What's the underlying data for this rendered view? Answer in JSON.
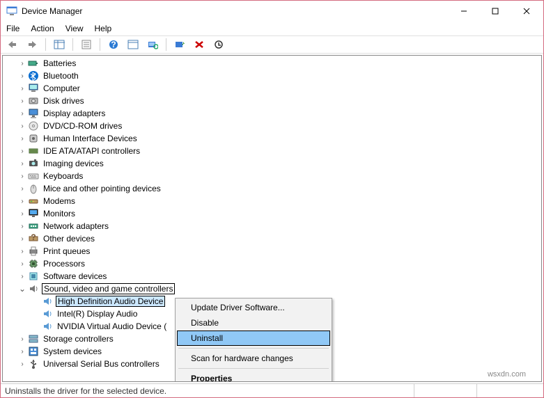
{
  "window": {
    "title": "Device Manager"
  },
  "menu": {
    "file": "File",
    "action": "Action",
    "view": "View",
    "help": "Help"
  },
  "tree": {
    "nodes": [
      {
        "label": "Batteries",
        "expanded": false,
        "icon": "battery"
      },
      {
        "label": "Bluetooth",
        "expanded": false,
        "icon": "bluetooth"
      },
      {
        "label": "Computer",
        "expanded": false,
        "icon": "computer"
      },
      {
        "label": "Disk drives",
        "expanded": false,
        "icon": "disk"
      },
      {
        "label": "Display adapters",
        "expanded": false,
        "icon": "display"
      },
      {
        "label": "DVD/CD-ROM drives",
        "expanded": false,
        "icon": "cd"
      },
      {
        "label": "Human Interface Devices",
        "expanded": false,
        "icon": "hid"
      },
      {
        "label": "IDE ATA/ATAPI controllers",
        "expanded": false,
        "icon": "ide"
      },
      {
        "label": "Imaging devices",
        "expanded": false,
        "icon": "imaging"
      },
      {
        "label": "Keyboards",
        "expanded": false,
        "icon": "keyboard"
      },
      {
        "label": "Mice and other pointing devices",
        "expanded": false,
        "icon": "mouse"
      },
      {
        "label": "Modems",
        "expanded": false,
        "icon": "modem"
      },
      {
        "label": "Monitors",
        "expanded": false,
        "icon": "monitor"
      },
      {
        "label": "Network adapters",
        "expanded": false,
        "icon": "network"
      },
      {
        "label": "Other devices",
        "expanded": false,
        "icon": "other"
      },
      {
        "label": "Print queues",
        "expanded": false,
        "icon": "printer"
      },
      {
        "label": "Processors",
        "expanded": false,
        "icon": "cpu"
      },
      {
        "label": "Software devices",
        "expanded": false,
        "icon": "software"
      },
      {
        "label": "Sound, video and game controllers",
        "expanded": true,
        "icon": "sound",
        "boxed": true,
        "children": [
          {
            "label": "High Definition Audio Device",
            "icon": "speaker",
            "selected": true
          },
          {
            "label": "Intel(R) Display Audio",
            "icon": "speaker"
          },
          {
            "label": "NVIDIA Virtual Audio Device (",
            "icon": "speaker"
          }
        ]
      },
      {
        "label": "Storage controllers",
        "expanded": false,
        "icon": "storage"
      },
      {
        "label": "System devices",
        "expanded": false,
        "icon": "system"
      },
      {
        "label": "Universal Serial Bus controllers",
        "expanded": false,
        "icon": "usb"
      }
    ]
  },
  "context_menu": {
    "items": [
      {
        "label": "Update Driver Software...",
        "type": "item"
      },
      {
        "label": "Disable",
        "type": "item"
      },
      {
        "label": "Uninstall",
        "type": "item",
        "highlighted": true
      },
      {
        "type": "sep"
      },
      {
        "label": "Scan for hardware changes",
        "type": "item"
      },
      {
        "type": "sep"
      },
      {
        "label": "Properties",
        "type": "item",
        "bold": true
      }
    ]
  },
  "statusbar": {
    "text": "Uninstalls the driver for the selected device."
  },
  "watermark": "wsxdn.com"
}
